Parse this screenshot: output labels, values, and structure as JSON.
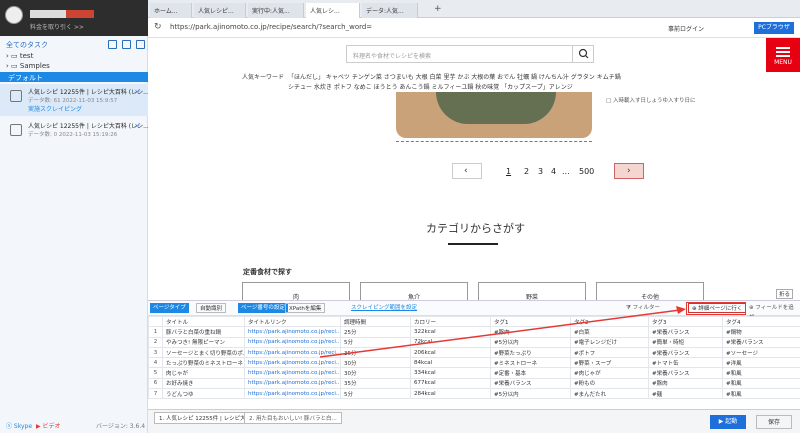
{
  "left": {
    "subtitle": "料金を取り引く >>",
    "tasks_title": "全てのタスク",
    "tree": [
      "test",
      "Samples"
    ],
    "group": "デフォルト",
    "tasks": [
      {
        "title": "人気レシピ 12255件 | レシピ大百科 (レシ...",
        "meta": "データ数: 61      2022-11-03 15:9:57",
        "status": "実施スクレイピング"
      },
      {
        "title": "人気レシピ 12255件 | レシピ大百科 (レシ...",
        "meta": "データ数: 0       2022-11-03 15:19:26",
        "status": ""
      }
    ],
    "footer": {
      "skype": "Skype",
      "video": "ビデオ",
      "version": "バージョン: 3.6.4"
    }
  },
  "browser": {
    "tabs": [
      "ホーム...",
      "人気レシピ...",
      "実行中:人気...",
      "人気レシ...",
      "データ:人気..."
    ],
    "url": "https://park.ajinomoto.co.jp/recipe/search/?search_word=",
    "login": "事前ログイン",
    "pc_browser": "PCブラウザ"
  },
  "page": {
    "search_placeholder": "料理名や食材でレシピを検索",
    "menu": "MENU",
    "keyword_label": "人気キーワード",
    "kw_line1": "「ほんだし」  キャベツ  チンゲン菜  さつまいも  大根  白菜  里芋  かぶ  大根の葉  おでん  牡蠣  鍋  けんちん汁  グラタン  キムチ鍋",
    "kw_line2": "シチュー  水炊き  ポトフ  なめこ  ほうとう  あんこう鍋  ミルフィーユ鍋  秋の味覚  「カップスープ」アレンジ",
    "side_text": "□ 入時載入す日しょうゆ入すり日に",
    "pages": [
      "1",
      "2",
      "3",
      "4",
      "...",
      "500"
    ],
    "category_heading": "カテゴリからさがす",
    "staple_heading": "定番食材で探す",
    "cards": [
      "肉",
      "魚介",
      "野菜",
      "その他"
    ]
  },
  "toolbar": {
    "data_type": "ページタイプ",
    "auto_detect": "自動識別",
    "page_settings": "ページ番号の設定",
    "xpath_edit": "XPathを編集",
    "scrape_range": "スクレイピング範囲を設定",
    "filter": "フィルター",
    "detail_page": "詳細ページに行く",
    "add_field": "フィールドを追加",
    "fold": "折る"
  },
  "table": {
    "headers": [
      "",
      "タイトル",
      "タイトルリンク",
      "調理時間",
      "カロリー",
      "タグ1",
      "タグ2",
      "タグ3",
      "タグ4"
    ],
    "rows": [
      [
        "1",
        "豚バラと白菜の重ね鍋",
        "https://park.ajinomoto.co.jp/reci...",
        "25分",
        "322kcal",
        "#豚肉",
        "#白菜",
        "#栄養バランス",
        "#鍋物"
      ],
      [
        "2",
        "やみつき! 無限ピーマン",
        "https://park.ajinomoto.co.jp/reci...",
        "5分",
        "72kcal",
        "#5分以内",
        "#電子レンジだけ",
        "#簡単・時短",
        "#栄養バランス"
      ],
      [
        "3",
        "ソーセージとまく切り野菜のポ...",
        "https://park.ajinomoto.co.jp/reci...",
        "35分",
        "206kcal",
        "#野菜たっぷり",
        "#ポトフ",
        "#栄養バランス",
        "#ソーセージ"
      ],
      [
        "4",
        "たっぷり野菜のミネストローネ",
        "https://park.ajinomoto.co.jp/reci...",
        "30分",
        "84kcal",
        "#ミネストローネ",
        "#野菜・スープ",
        "#トマト缶",
        "#洋風"
      ],
      [
        "5",
        "肉じゃが",
        "https://park.ajinomoto.co.jp/reci...",
        "30分",
        "334kcal",
        "#定番・基本",
        "#肉じゃが",
        "#栄養バランス",
        "#和風"
      ],
      [
        "6",
        "お好み焼き",
        "https://park.ajinomoto.co.jp/reci...",
        "35分",
        "677kcal",
        "#栄養バランス",
        "#粉もの",
        "#豚肉",
        "#和風"
      ],
      [
        "7",
        "うどんつゆ",
        "https://park.ajinomoto.co.jp/reci...",
        "5分",
        "284kcal",
        "#5分以内",
        "#まんだたれ",
        "#麺",
        "#和風"
      ]
    ]
  },
  "bottom": {
    "tab1": "1. 人気レシピ 12255件 | レシピ大...",
    "tab2": "2. 用た目もおいしい! 豚バラと白...",
    "start": "起動",
    "save": "保存"
  }
}
